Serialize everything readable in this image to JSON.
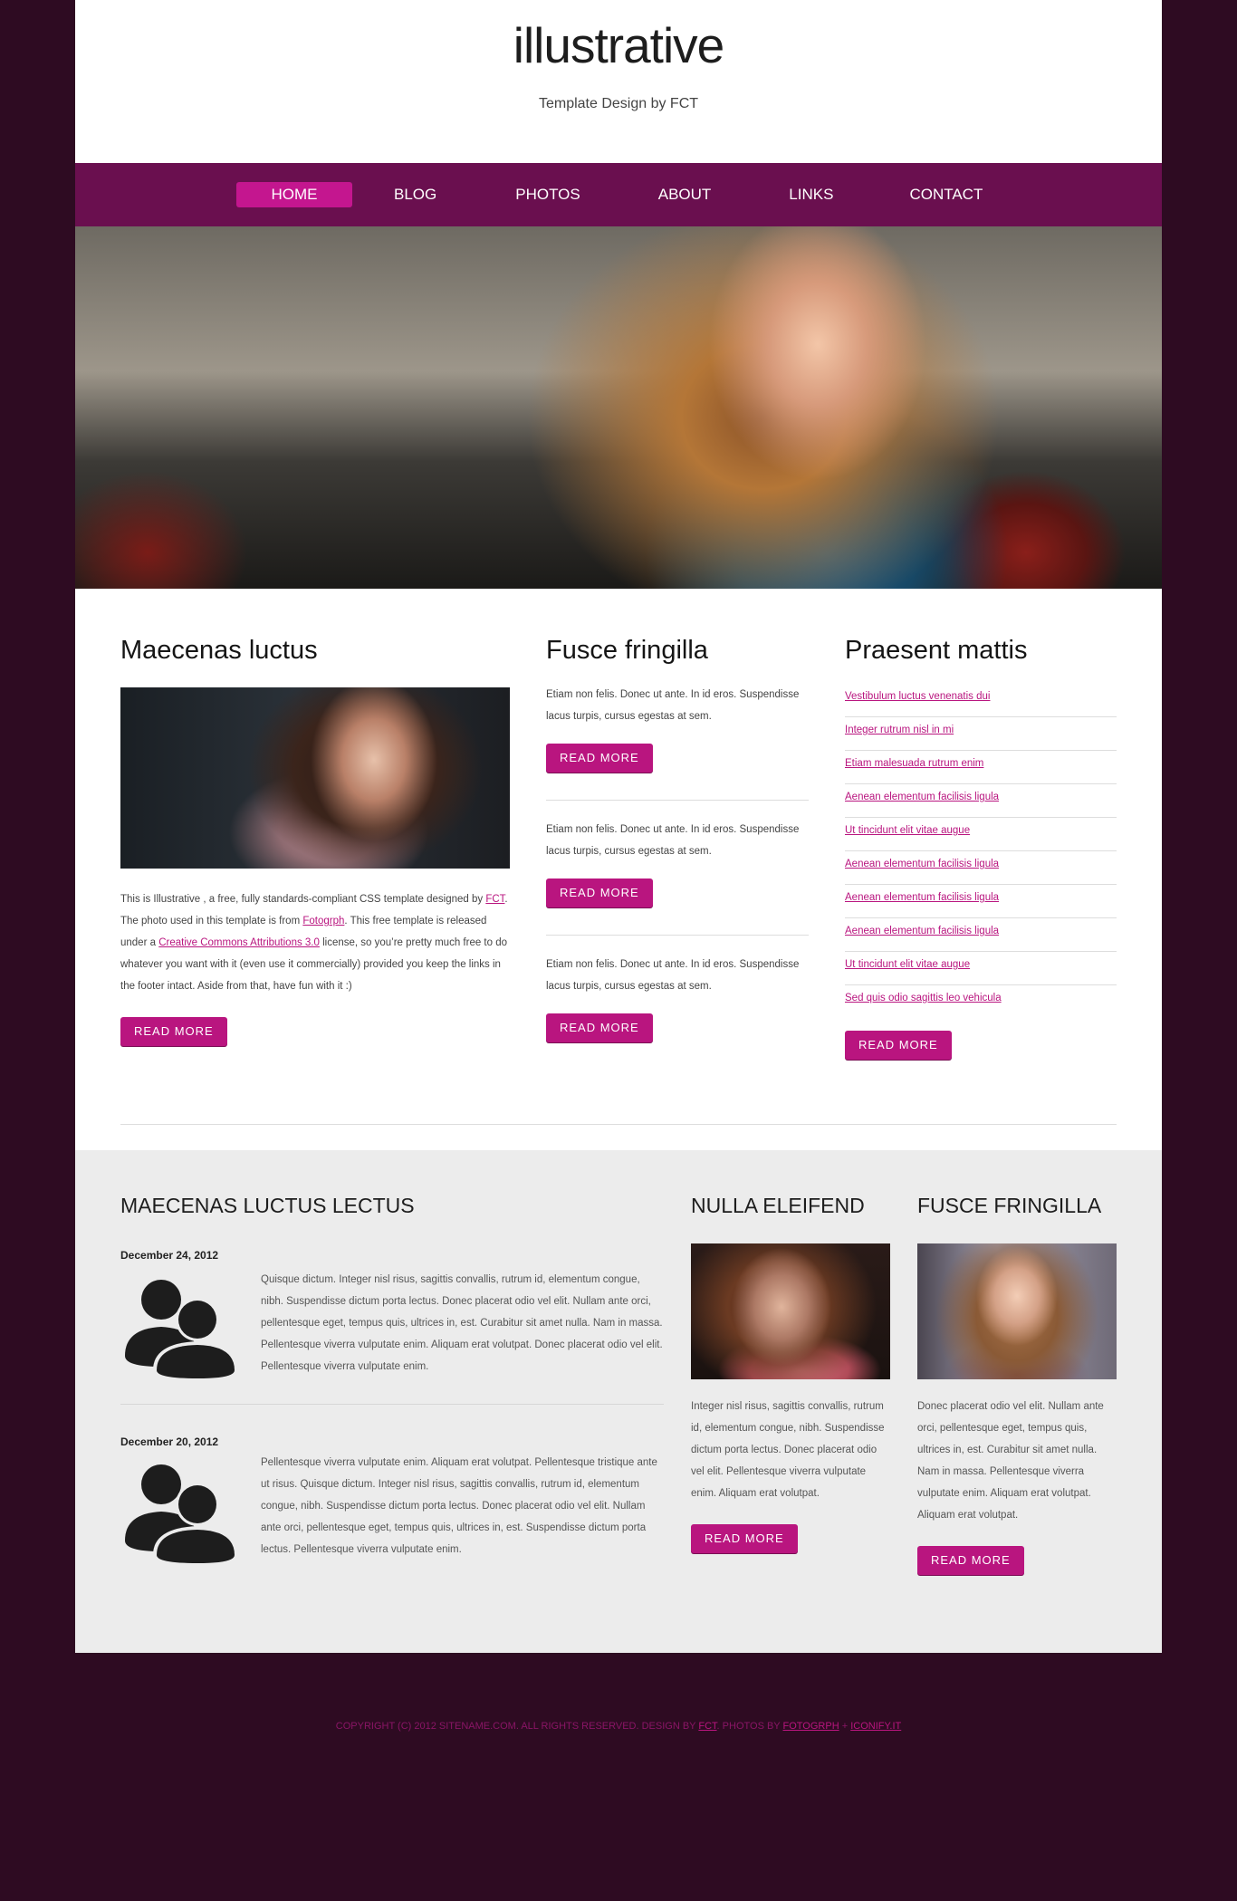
{
  "header": {
    "title": "illustrative",
    "tagline": "Template Design by FCT"
  },
  "nav": {
    "items": [
      "HOME",
      "BLOG",
      "PHOTOS",
      "ABOUT",
      "LINKS",
      "CONTACT"
    ]
  },
  "col1": {
    "title": "Maecenas luctus",
    "text1": "This is Illustrative , a free, fully standards-compliant CSS template designed by ",
    "link1": "FCT",
    "text2": ". The photo used in this template is from ",
    "link2": "Fotogrph",
    "text3": ". This free template is released under a ",
    "link3": "Creative Commons Attributions 3.0",
    "text4": " license, so you’re pretty much free to do whatever you want with it (even use it commercially) provided you keep the links in the footer intact. Aside from that, have fun with it :)",
    "button": "READ MORE"
  },
  "col2": {
    "title": "Fusce fringilla",
    "items": [
      {
        "text": "Etiam non felis. Donec ut ante. In id eros. Suspendisse lacus turpis, cursus egestas at sem.",
        "button": "READ MORE"
      },
      {
        "text": "Etiam non felis. Donec ut ante. In id eros. Suspendisse lacus turpis, cursus egestas at sem.",
        "button": "READ MORE"
      },
      {
        "text": "Etiam non felis. Donec ut ante. In id eros. Suspendisse lacus turpis, cursus egestas at sem.",
        "button": "READ MORE"
      }
    ]
  },
  "col3": {
    "title": "Praesent mattis",
    "links": [
      "Vestibulum luctus venenatis dui",
      "Integer rutrum nisl in mi",
      "Etiam malesuada rutrum enim",
      "Aenean elementum facilisis ligula",
      "Ut tincidunt elit vitae augue",
      "Aenean elementum facilisis ligula",
      "Aenean elementum facilisis ligula",
      "Aenean elementum facilisis ligula",
      "Ut tincidunt elit vitae augue",
      "Sed quis odio sagittis leo vehicula"
    ],
    "button": "READ MORE"
  },
  "lower": {
    "col1": {
      "title": "MAECENAS LUCTUS LECTUS",
      "posts": [
        {
          "date": "December 24, 2012",
          "text": "Quisque dictum. Integer nisl risus, sagittis convallis, rutrum id, elementum congue, nibh. Suspendisse dictum porta lectus. Donec placerat odio vel elit. Nullam ante orci, pellentesque eget, tempus quis, ultrices in, est. Curabitur sit amet nulla. Nam in massa. Pellentesque viverra vulputate enim. Aliquam erat volutpat. Donec placerat odio vel elit. Pellentesque viverra vulputate enim."
        },
        {
          "date": "December 20, 2012",
          "text": "Pellentesque viverra vulputate enim. Aliquam erat volutpat. Pellentesque tristique ante ut risus. Quisque dictum. Integer nisl risus, sagittis convallis, rutrum id, elementum congue, nibh. Suspendisse dictum porta lectus. Donec placerat odio vel elit. Nullam ante orci, pellentesque eget, tempus quis, ultrices in, est. Suspendisse dictum porta lectus. Pellentesque viverra vulputate enim."
        }
      ]
    },
    "col2": {
      "title": "NULLA ELEIFEND",
      "text": "Integer nisl risus, sagittis convallis, rutrum id, elementum congue, nibh. Suspendisse dictum porta lectus. Donec placerat odio vel elit. Pellentesque viverra vulputate enim. Aliquam erat volutpat.",
      "button": "READ MORE"
    },
    "col3": {
      "title": "FUSCE FRINGILLA",
      "text": "Donec placerat odio vel elit. Nullam ante orci, pellentesque eget, tempus quis, ultrices in, est. Curabitur sit amet nulla. Nam in massa. Pellentesque viverra vulputate enim. Aliquam erat volutpat. Aliquam erat volutpat.",
      "button": "READ MORE"
    }
  },
  "footer": {
    "text1": "COPYRIGHT (C) 2012 SITENAME.COM. ALL RIGHTS RESERVED. DESIGN BY ",
    "link1": "FCT",
    "text2": ". PHOTOS BY ",
    "link2": "FOTOGRPH",
    "text3": " + ",
    "link3": "ICONIFY.IT"
  },
  "colors": {
    "background": "#2e0b22",
    "nav": "#6a0f4f",
    "accent": "#b9157f",
    "nav_active": "#c4168f",
    "lower_bg": "#ececec"
  },
  "icons": {
    "post_avatar": "user-group-icon"
  }
}
